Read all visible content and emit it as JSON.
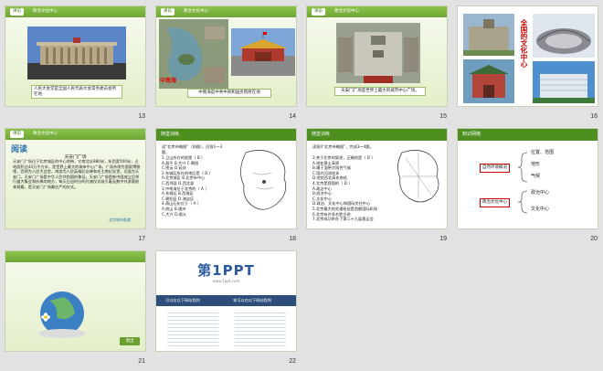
{
  "app": {
    "view": "slide-sorter"
  },
  "colors": {
    "theme_green": "#8bc34a",
    "dark_green": "#4f8f22",
    "accent_red": "#cc0000",
    "background": "#e2e2e2"
  },
  "slides": {
    "s13": {
      "number": "13",
      "header_tag": "课前",
      "header_section": "政治文化中心",
      "caption": "人民大会堂是全国人民代表大会常务委员会所在地"
    },
    "s14": {
      "number": "14",
      "header_tag": "课前",
      "header_section": "政治文化中心",
      "overlay_label": "中南海",
      "caption": "中南海是中共中央和国务院所在地"
    },
    "s15": {
      "number": "15",
      "header_tag": "课前",
      "header_section": "政治文化中心",
      "caption": "天安门广场是世界上最大的城市中心广场。"
    },
    "s16": {
      "number": "16",
      "vertical_title": "全国的文化中心"
    },
    "s17": {
      "number": "17",
      "header_tag": "课前",
      "header_section": "政治文化中心",
      "title": "阅读",
      "subtitle": "天安门广场",
      "body": "天安门广场位于北京城区的中心地带，它南北长880米，东西宽500米，占地面积达44万平方米，是世界上最大的城市中心广场。广场东侧为国家博物馆，西侧为人民大会堂，南部为人民英雄纪念碑和毛主席纪念堂，北面为天安门。天安门广场是中华人民共和国的象征。天安门广场是新中国成立后举行盛大集会和庆典的地方，每天日出时分的升旗仪式吸引着无数中外游客前来观看，是天安门广场最庄严的仪式。",
      "footer": "北京城市面貌"
    },
    "s18": {
      "number": "18",
      "header_title": "随堂训练",
      "question": "读“北京市略图”（如图），回答1～3题。",
      "items": [
        "1.卫山所在的地是（ B ）",
        "A.昌平 B.大兴 C.朝阳",
        "C.密云 D.延庆",
        "2.东城区所在的地区是（ B ）",
        "A.北京城区 B.北京市中心",
        "C.西郊县 D.西北部",
        "3.中南海位于北京的（ A ）",
        "A.东城区 B.西城区",
        "C.朝阳区 D.海淀区",
        "4.燕山石化位于（ A ）",
        "A.房山 B.通州",
        "C.大兴 D.顺义"
      ]
    },
    "s19": {
      "number": "19",
      "header_title": "随堂训练",
      "question": "读图4“北京市略图”，完成3～4题。",
      "items": [
        "3.关于北京的叙述，正确的是（ D ）",
        "A.地处黄土高原",
        "B.属于温带大陆性气候",
        "C.国内河流较多",
        "D.地势西北高东南低",
        "4.北京是我国的（ D ）",
        "A.政治中心",
        "B.经济中心",
        "C.文化中心",
        "D.政治、文化中心和国际交往中心",
        "5.北京最大的交通枢纽是首都国际机场",
        "6.北京有许多名胜古迹",
        "7.北京成功举办了第二十九届奥运会"
      ]
    },
    "s20": {
      "number": "20",
      "header_title": "知识网络",
      "node_a": "自然环境概况",
      "node_b": "政治文化中心",
      "leaves_a": [
        "位置、范围",
        "地形",
        "气候"
      ],
      "leaves_b": [
        "政治中心",
        "文化中心"
      ]
    },
    "s21": {
      "number": "21",
      "button_label": "退出"
    },
    "s22": {
      "number": "22",
      "logo_text": "第1PPT",
      "logo_sub": "www.1ppt.com",
      "left_heading": "可以在以下网站找到",
      "right_heading": "本可以在以下网站找到"
    }
  }
}
